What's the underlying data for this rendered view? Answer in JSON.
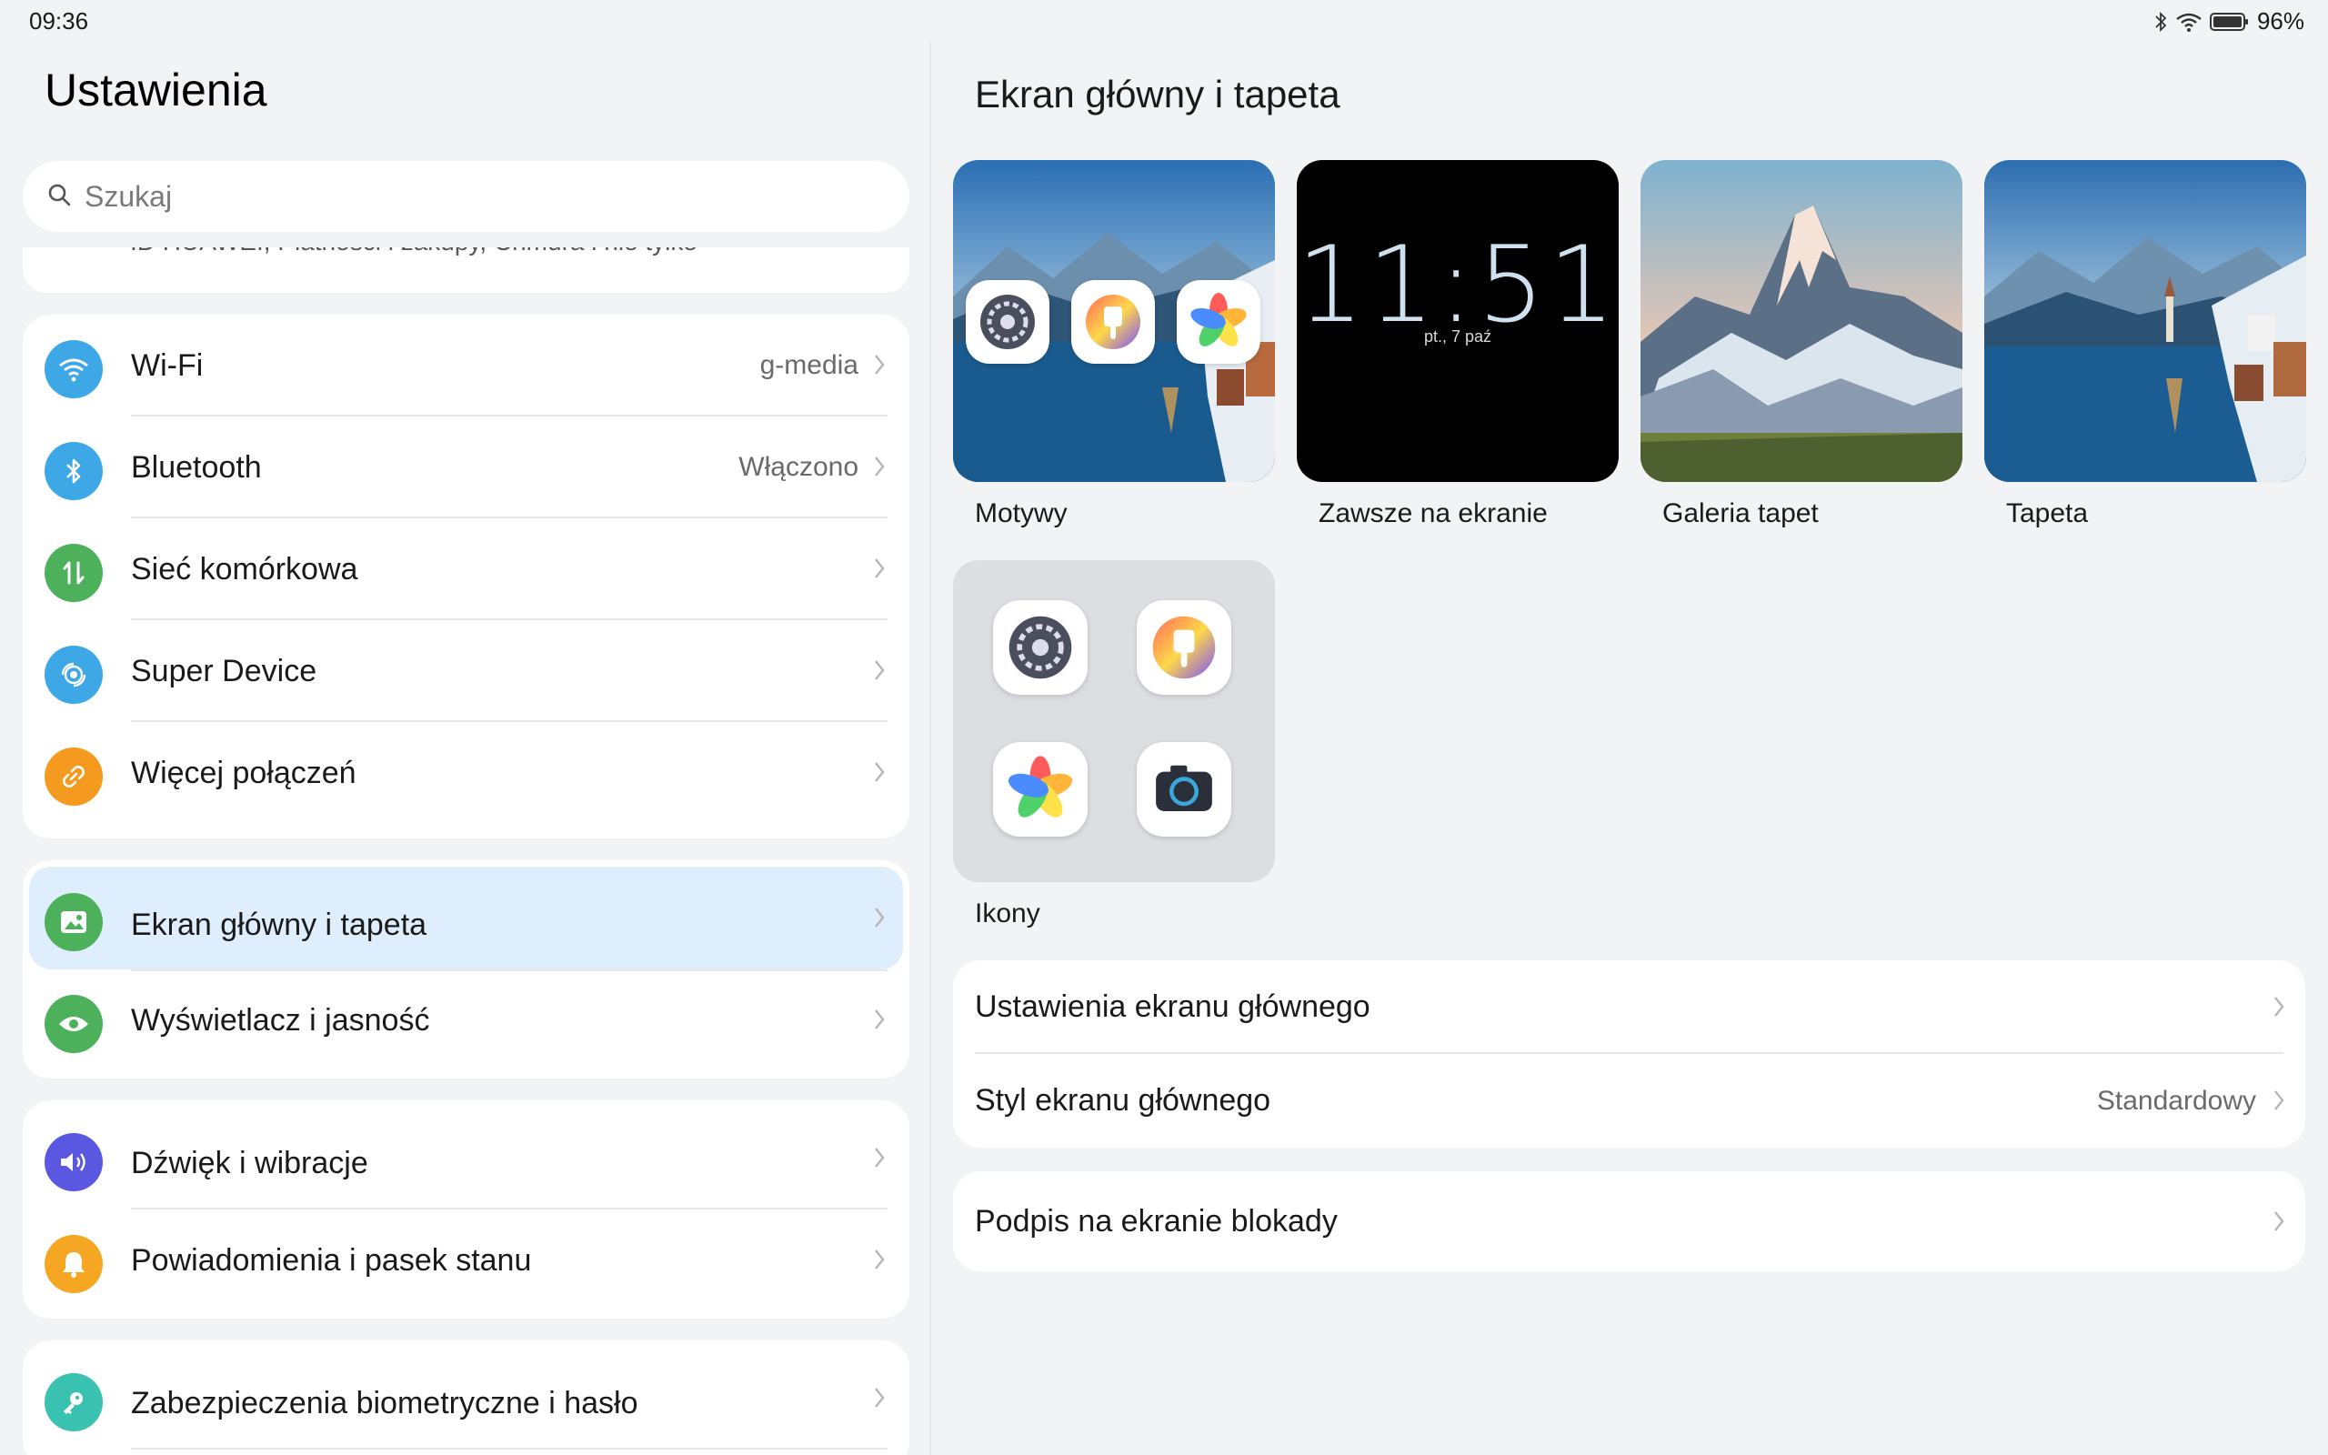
{
  "status_bar": {
    "time": "09:36",
    "battery": "96%"
  },
  "settings": {
    "title": "Ustawienia",
    "search_placeholder": "Szukaj",
    "account_peek": "ID HUAWEI, Płatności i zakupy, Chmura i nie tylko",
    "groups": [
      [
        {
          "label": "Wi-Fi",
          "value": "g-media",
          "icon": "wifi-icon",
          "color": "#3ea8e6"
        },
        {
          "label": "Bluetooth",
          "value": "Włączono",
          "icon": "bluetooth-icon",
          "color": "#3ea8e6"
        },
        {
          "label": "Sieć komórkowa",
          "value": "",
          "icon": "mobile-data-icon",
          "color": "#4cb15a"
        },
        {
          "label": "Super Device",
          "value": "",
          "icon": "super-device-icon",
          "color": "#3ea8e6"
        },
        {
          "label": "Więcej połączeń",
          "value": "",
          "icon": "link-icon",
          "color": "#f39a1f"
        }
      ],
      [
        {
          "label": "Ekran główny i tapeta",
          "value": "",
          "icon": "image-icon",
          "color": "#4cb15a",
          "selected": true
        },
        {
          "label": "Wyświetlacz i jasność",
          "value": "",
          "icon": "eye-icon",
          "color": "#4cb15a"
        }
      ],
      [
        {
          "label": "Dźwięk i wibracje",
          "value": "",
          "icon": "speaker-icon",
          "color": "#5a57e0"
        },
        {
          "label": "Powiadomienia i pasek stanu",
          "value": "",
          "icon": "bell-icon",
          "color": "#f5a623"
        }
      ],
      [
        {
          "label": "Zabezpieczenia biometryczne i hasło",
          "value": "",
          "icon": "key-icon",
          "color": "#3ac2b0"
        }
      ]
    ]
  },
  "detail": {
    "title": "Ekran główny i tapeta",
    "tiles": [
      {
        "label": "Motywy"
      },
      {
        "label": "Zawsze na ekranie",
        "clock": "11:51",
        "date": "pt., 7 paź"
      },
      {
        "label": "Galeria tapet"
      },
      {
        "label": "Tapeta"
      }
    ],
    "icons_tile": {
      "label": "Ikony"
    },
    "rows_group1": [
      {
        "label": "Ustawienia ekranu głównego",
        "value": ""
      },
      {
        "label": "Styl ekranu głównego",
        "value": "Standardowy"
      }
    ],
    "rows_group2": [
      {
        "label": "Podpis na ekranie blokady",
        "value": ""
      }
    ]
  }
}
